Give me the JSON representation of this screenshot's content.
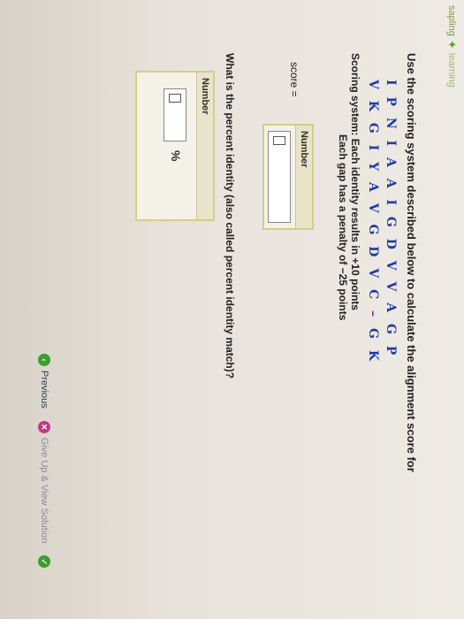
{
  "brand": {
    "name": "sapling",
    "sub": "learning"
  },
  "question": "Use the scoring system described below to calculate the alignment score for",
  "sequences": {
    "seq1": [
      "I",
      "P",
      "N",
      "I",
      "A",
      "A",
      "I",
      "G",
      "D",
      "V",
      "V",
      "A",
      "G",
      "P"
    ],
    "seq2": [
      "V",
      "K",
      "G",
      "I",
      "Y",
      "A",
      "V",
      "G",
      "D",
      "V",
      "C",
      "–",
      "G",
      "K"
    ]
  },
  "scoring": {
    "line1": "Scoring system: Each identity results in +10 points",
    "line2": "Each gap has a penalty of −25 points"
  },
  "score": {
    "label": "score =",
    "box_header": "Number",
    "value": ""
  },
  "q2": "What is the percent identity (also called percent identity match)?",
  "percent": {
    "box_header": "Number",
    "unit": "%",
    "value": ""
  },
  "footer": {
    "previous": "Previous",
    "giveup": "Give Up & View Solution",
    "next_icon": "check-icon"
  },
  "colors": {
    "brand": "#7da23a",
    "sequence": "#1e3aa8",
    "giveup_icon": "#c23a8a"
  }
}
